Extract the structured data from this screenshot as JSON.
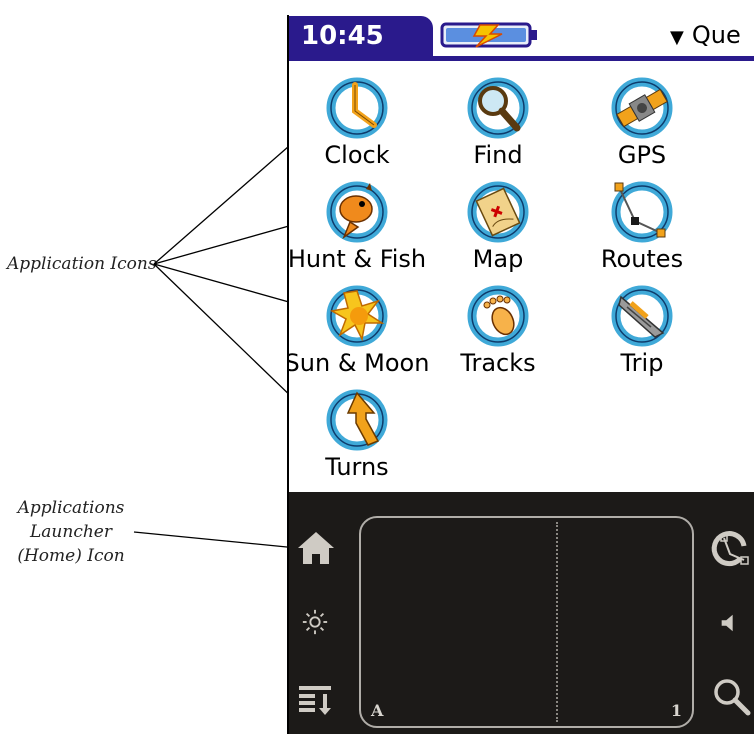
{
  "status_bar": {
    "time": "10:45 am",
    "battery_icon": "battery-charging-icon",
    "category_label": "Que",
    "category_arrow": "▼"
  },
  "apps": [
    {
      "label": "Clock",
      "icon": "clock-icon"
    },
    {
      "label": "Find",
      "icon": "magnifier-icon"
    },
    {
      "label": "GPS",
      "icon": "satellite-icon"
    },
    {
      "label": "Hunt & Fish",
      "icon": "fish-icon"
    },
    {
      "label": "Map",
      "icon": "map-icon"
    },
    {
      "label": "Routes",
      "icon": "route-icon"
    },
    {
      "label": "Sun & Moon",
      "icon": "sun-icon"
    },
    {
      "label": "Tracks",
      "icon": "footprint-icon"
    },
    {
      "label": "Trip",
      "icon": "boat-icon"
    },
    {
      "label": "Turns",
      "icon": "turn-arrow-icon"
    }
  ],
  "graffiti_area": {
    "left_label": "A",
    "right_label": "1",
    "left_icons": [
      "home-icon",
      "brightness-icon",
      "menu-icon"
    ],
    "right_icons": [
      "routes-shortcut-icon",
      "speaker-icon",
      "find-icon"
    ]
  },
  "callouts": {
    "application_icons": "Application Icons",
    "launcher_line1": "Applications",
    "launcher_line2": "Launcher",
    "launcher_line3": "(Home) Icon"
  },
  "colors": {
    "title_bar": "#2a1a8c",
    "icon_ring": "#3fa9d8",
    "icon_accent": "#f2a21b",
    "graffiti_bg": "#1c1a18"
  }
}
